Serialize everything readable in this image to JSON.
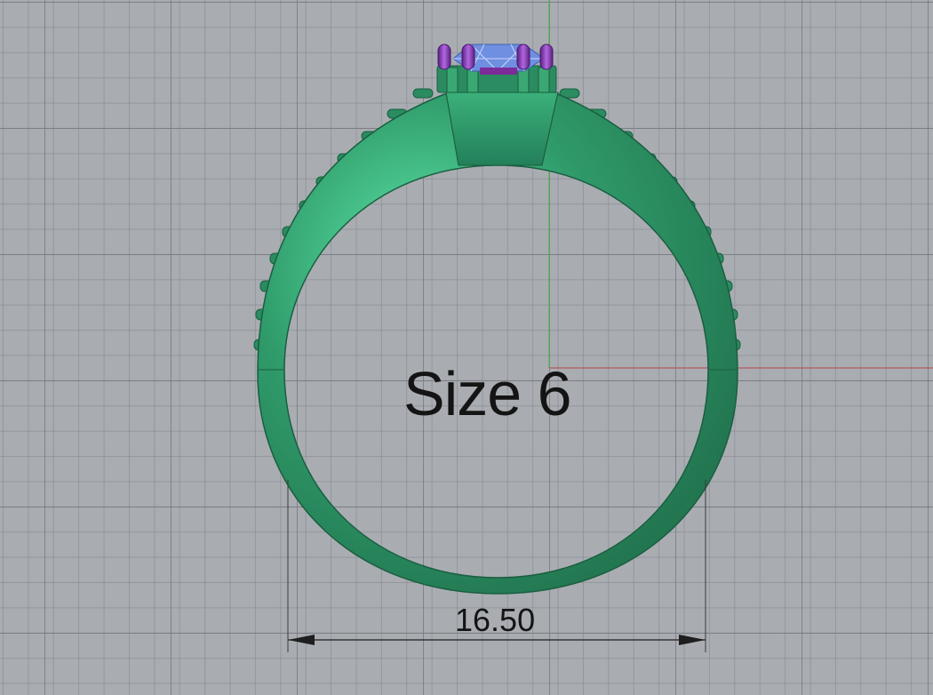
{
  "viewport": {
    "background_color": "#a9adb2",
    "grid_color": "#8a8e93",
    "x_axis_color": "#b55a5a",
    "y_axis_color": "#4fae4f"
  },
  "model": {
    "ring_color": "#2f9a6a",
    "prong_color": "#8a3fb3",
    "gem_color": "#6f8fe0",
    "size_label": "Size 6"
  },
  "dimension": {
    "value": "16.50",
    "line_color": "#1e1e1e"
  }
}
